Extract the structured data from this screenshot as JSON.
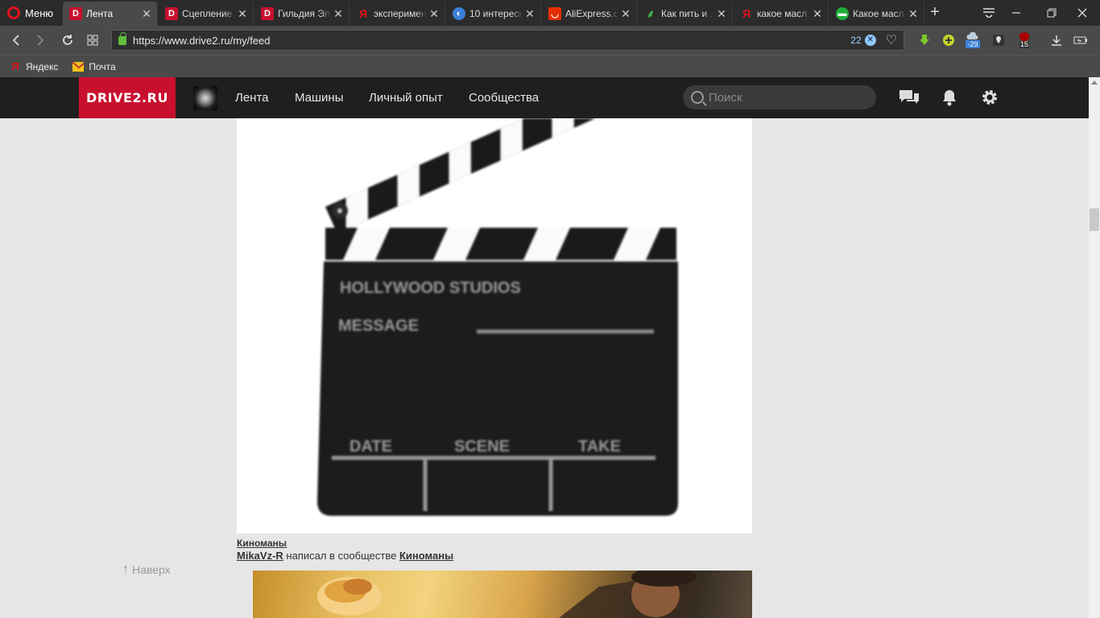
{
  "browser": {
    "menu_label": "Меню",
    "tabs": [
      {
        "title": "Лента",
        "favicon": "drive2-icon",
        "active": true
      },
      {
        "title": "Сцепление",
        "favicon": "drive2-icon"
      },
      {
        "title": "Гильдия Эл...",
        "favicon": "drive2-icon"
      },
      {
        "title": "эксперимен...",
        "favicon": "yandex-icon"
      },
      {
        "title": "10 интересн...",
        "favicon": "globe-icon"
      },
      {
        "title": "AliExpress.co...",
        "favicon": "aliexpress-icon"
      },
      {
        "title": "Как пить и ...",
        "favicon": "leaf-icon"
      },
      {
        "title": "какое масл...",
        "favicon": "yandex-icon"
      },
      {
        "title": "Какое масл...",
        "favicon": "car-icon"
      }
    ],
    "url": "https://www.drive2.ru/my/feed",
    "ad_block_count": "22",
    "weather_temp": "-29",
    "ublock_count": "15",
    "bookmarks": [
      {
        "label": "Яндекс",
        "icon": "yandex-icon"
      },
      {
        "label": "Почта",
        "icon": "mail-icon"
      }
    ]
  },
  "site": {
    "logo": "DRIVE2.RU",
    "nav": [
      "Лента",
      "Машины",
      "Личный опыт",
      "Сообщества"
    ],
    "search_placeholder": "Поиск"
  },
  "post": {
    "community_tag": "Киноманы",
    "author": "MikaVz-R",
    "action_text": "написал в сообществе",
    "community": "Киноманы"
  },
  "clapper_text": {
    "studio": "HOLLYWOOD STUDIOS",
    "message": "MESSAGE",
    "date": "DATE",
    "scene": "SCENE",
    "take": "TAKE"
  },
  "back_to_top": "Наверх",
  "colors": {
    "brand_red": "#c8102e",
    "header_bg": "#1f1f1f",
    "page_bg": "#e6e6e6"
  }
}
